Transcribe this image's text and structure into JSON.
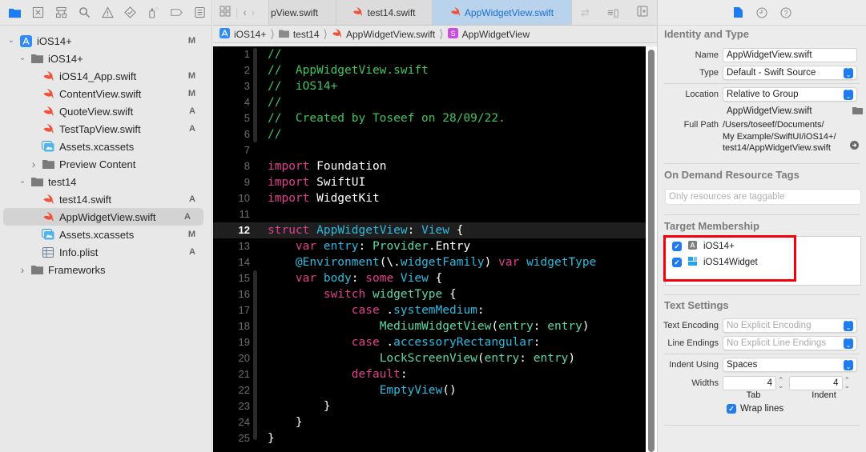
{
  "navigator": {
    "toolbar_icons": [
      "folder-icon",
      "source-control-icon",
      "hierarchy-icon",
      "search-icon",
      "warning-icon",
      "test-icon",
      "debug-icon",
      "breakpoint-icon",
      "report-icon"
    ],
    "items": [
      {
        "label": "iOS14+",
        "icon": "app-project-icon",
        "badge": "M",
        "level": 0,
        "expanded": true
      },
      {
        "label": "iOS14+",
        "icon": "folder-icon",
        "badge": "",
        "level": 1,
        "expanded": true
      },
      {
        "label": "iOS14_App.swift",
        "icon": "swift-icon",
        "badge": "M",
        "level": 2
      },
      {
        "label": "ContentView.swift",
        "icon": "swift-icon",
        "badge": "M",
        "level": 2
      },
      {
        "label": "QuoteView.swift",
        "icon": "swift-icon",
        "badge": "A",
        "level": 2
      },
      {
        "label": "TestTapView.swift",
        "icon": "swift-icon",
        "badge": "A",
        "level": 2
      },
      {
        "label": "Assets.xcassets",
        "icon": "assets-icon",
        "badge": "",
        "level": 2
      },
      {
        "label": "Preview Content",
        "icon": "folder-icon",
        "badge": "",
        "level": 2,
        "expanded": false,
        "collapsible": true
      },
      {
        "label": "test14",
        "icon": "folder-icon",
        "badge": "",
        "level": 1,
        "expanded": true
      },
      {
        "label": "test14.swift",
        "icon": "swift-icon",
        "badge": "A",
        "level": 2
      },
      {
        "label": "AppWidgetView.swift",
        "icon": "swift-icon",
        "badge": "A",
        "level": 2,
        "selected": true
      },
      {
        "label": "Assets.xcassets",
        "icon": "assets-icon",
        "badge": "M",
        "level": 2
      },
      {
        "label": "Info.plist",
        "icon": "plist-icon",
        "badge": "A",
        "level": 2
      },
      {
        "label": "Frameworks",
        "icon": "folder-icon",
        "badge": "",
        "level": 1,
        "expanded": false,
        "collapsible": true
      }
    ]
  },
  "editor": {
    "tabs": [
      {
        "label": "pView.swift",
        "active": false
      },
      {
        "label": "test14.swift",
        "active": false
      },
      {
        "label": "AppWidgetView.swift",
        "active": true
      }
    ],
    "breadcrumb": [
      "iOS14+",
      "test14",
      "AppWidgetView.swift",
      "AppWidgetView"
    ],
    "current_line": 12,
    "lines": [
      [
        [
          "c-comment",
          "//"
        ]
      ],
      [
        [
          "c-comment",
          "//  AppWidgetView.swift"
        ]
      ],
      [
        [
          "c-comment",
          "//  iOS14+"
        ]
      ],
      [
        [
          "c-comment",
          "//"
        ]
      ],
      [
        [
          "c-comment",
          "//  Created by Toseef on 28/09/22."
        ]
      ],
      [
        [
          "c-comment",
          "//"
        ]
      ],
      [],
      [
        [
          "c-kw",
          "import"
        ],
        [
          "c-plain",
          " Foundation"
        ]
      ],
      [
        [
          "c-kw",
          "import"
        ],
        [
          "c-plain",
          " SwiftUI"
        ]
      ],
      [
        [
          "c-kw",
          "import"
        ],
        [
          "c-plain",
          " WidgetKit"
        ]
      ],
      [],
      [
        [
          "c-kw",
          "struct"
        ],
        [
          "c-plain",
          " "
        ],
        [
          "c-type",
          "AppWidgetView"
        ],
        [
          "c-plain",
          ": "
        ],
        [
          "c-type",
          "View"
        ],
        [
          "c-plain",
          " {"
        ]
      ],
      [
        [
          "c-plain",
          "    "
        ],
        [
          "c-kw",
          "var"
        ],
        [
          "c-plain",
          " "
        ],
        [
          "c-type",
          "entry"
        ],
        [
          "c-plain",
          ": "
        ],
        [
          "c-fn",
          "Provider"
        ],
        [
          "c-plain",
          "."
        ],
        [
          "c-plain",
          "Entry"
        ]
      ],
      [
        [
          "c-plain",
          "    "
        ],
        [
          "c-type",
          "@Environment"
        ],
        [
          "c-plain",
          "(\\."
        ],
        [
          "c-type",
          "widgetFamily"
        ],
        [
          "c-plain",
          ") "
        ],
        [
          "c-kw",
          "var"
        ],
        [
          "c-plain",
          " "
        ],
        [
          "c-type",
          "widgetType"
        ]
      ],
      [
        [
          "c-plain",
          "    "
        ],
        [
          "c-kw",
          "var"
        ],
        [
          "c-plain",
          " "
        ],
        [
          "c-type",
          "body"
        ],
        [
          "c-plain",
          ": "
        ],
        [
          "c-kw",
          "some"
        ],
        [
          "c-plain",
          " "
        ],
        [
          "c-type",
          "View"
        ],
        [
          "c-plain",
          " {"
        ]
      ],
      [
        [
          "c-plain",
          "        "
        ],
        [
          "c-kw",
          "switch"
        ],
        [
          "c-plain",
          " "
        ],
        [
          "c-fn",
          "widgetType"
        ],
        [
          "c-plain",
          " {"
        ]
      ],
      [
        [
          "c-plain",
          "            "
        ],
        [
          "c-kw",
          "case"
        ],
        [
          "c-plain",
          " ."
        ],
        [
          "c-type",
          "systemMedium"
        ],
        [
          "c-plain",
          ":"
        ]
      ],
      [
        [
          "c-plain",
          "                "
        ],
        [
          "c-fn",
          "MediumWidgetView"
        ],
        [
          "c-plain",
          "("
        ],
        [
          "c-fn",
          "entry"
        ],
        [
          "c-plain",
          ": "
        ],
        [
          "c-fn",
          "entry"
        ],
        [
          "c-plain",
          ")"
        ]
      ],
      [
        [
          "c-plain",
          "            "
        ],
        [
          "c-kw",
          "case"
        ],
        [
          "c-plain",
          " ."
        ],
        [
          "c-type",
          "accessoryRectangular"
        ],
        [
          "c-plain",
          ":"
        ]
      ],
      [
        [
          "c-plain",
          "                "
        ],
        [
          "c-fn",
          "LockScreenView"
        ],
        [
          "c-plain",
          "("
        ],
        [
          "c-fn",
          "entry"
        ],
        [
          "c-plain",
          ": "
        ],
        [
          "c-fn",
          "entry"
        ],
        [
          "c-plain",
          ")"
        ]
      ],
      [
        [
          "c-plain",
          "            "
        ],
        [
          "c-kw",
          "default"
        ],
        [
          "c-plain",
          ":"
        ]
      ],
      [
        [
          "c-plain",
          "                "
        ],
        [
          "c-type",
          "EmptyView"
        ],
        [
          "c-plain",
          "()"
        ]
      ],
      [
        [
          "c-plain",
          "        }"
        ]
      ],
      [
        [
          "c-plain",
          "    }"
        ]
      ],
      [
        [
          "c-plain",
          "}"
        ]
      ]
    ]
  },
  "inspector": {
    "tabs": [
      "file-inspector-icon",
      "history-icon",
      "help-icon"
    ],
    "identity": {
      "title": "Identity and Type",
      "name_label": "Name",
      "name_value": "AppWidgetView.swift",
      "type_label": "Type",
      "type_value": "Default - Swift Source",
      "location_label": "Location",
      "location_value": "Relative to Group",
      "location_file": "AppWidgetView.swift",
      "fullpath_label": "Full Path",
      "fullpath_lines": [
        "/Users/toseef/Documents/",
        "My Example/SwiftUI/iOS14+/",
        "test14/AppWidgetView.swift"
      ]
    },
    "odr": {
      "title": "On Demand Resource Tags",
      "placeholder": "Only resources are taggable"
    },
    "target": {
      "title": "Target Membership",
      "items": [
        {
          "label": "iOS14+",
          "checked": true,
          "icon": "app-target-icon"
        },
        {
          "label": "iOS14Widget",
          "checked": true,
          "icon": "widget-target-icon"
        }
      ]
    },
    "text": {
      "title": "Text Settings",
      "encoding_label": "Text Encoding",
      "encoding_value": "No Explicit Encoding",
      "endings_label": "Line Endings",
      "endings_value": "No Explicit Line Endings",
      "indent_label": "Indent Using",
      "indent_value": "Spaces",
      "widths_label": "Widths",
      "tab_width": "4",
      "indent_width": "4",
      "tab_caption": "Tab",
      "indent_caption": "Indent",
      "wrap_label": "Wrap lines",
      "wrap_checked": true
    }
  },
  "colors": {
    "accent": "#1e7cf0",
    "highlight_box": "#f5000a",
    "swift": "#f05138"
  }
}
